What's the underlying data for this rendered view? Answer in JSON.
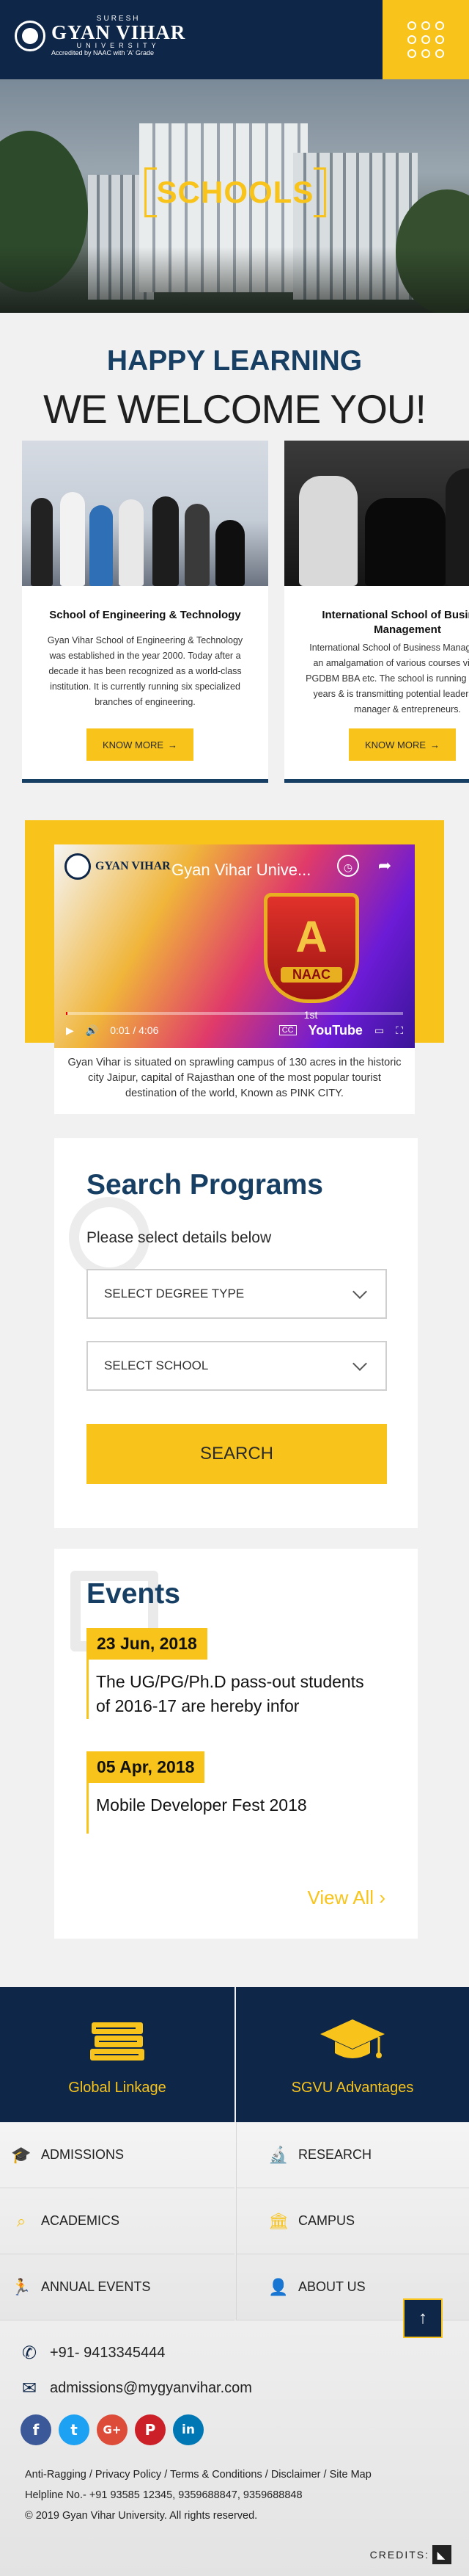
{
  "header": {
    "logo_top": "SURESH",
    "logo_name": "GYAN VIHAR",
    "logo_university": "UNIVERSITY",
    "logo_accreditation": "Accredited by NAAC with 'A' Grade"
  },
  "hero": {
    "title": "SCHOOLS"
  },
  "intro": {
    "tagline": "HAPPY LEARNING",
    "welcome": "WE WELCOME YOU!"
  },
  "schools": [
    {
      "title": "School of Engineering & Technology",
      "desc": "Gyan Vihar School of Engineering & Technology was established in the year 2000. Today after a decade it has been recognized as a world-class institution. It is currently running six specialized branches of engineering.",
      "button": "KNOW MORE"
    },
    {
      "title": "International School of Business Management",
      "desc": "International School of Business Management is an amalgamation of various courses viz. MBA, PGDBM BBA etc. The school is running for last 12 years & is transmitting potential leaders, future manager & entrepreneurs.",
      "button": "KNOW MORE"
    }
  ],
  "video": {
    "title": "Gyan Vihar Unive...",
    "badge_a": "A",
    "badge_naac": "NAAC",
    "badge_rank": "1st",
    "time": "0:01 / 4:06",
    "cc": "CC",
    "brand": "YouTube",
    "caption": "Gyan Vihar is situated on sprawling campus of 130 acres in the historic city Jaipur, capital of Rajasthan one of the most popular tourist destination of the world, Known as PINK CITY."
  },
  "search_programs": {
    "title": "Search Programs",
    "subtitle": "Please select details below",
    "degree_select": "SELECT DEGREE TYPE",
    "school_select": "SELECT SCHOOL",
    "button": "SEARCH"
  },
  "events": {
    "title": "Events",
    "items": [
      {
        "date": "23 Jun, 2018",
        "text": "The UG/PG/Ph.D pass-out students of 2016-17 are hereby infor"
      },
      {
        "date": "05 Apr, 2018",
        "text": "Mobile Developer Fest 2018"
      }
    ],
    "view_all": "View All"
  },
  "links": {
    "global": "Global Linkage",
    "advantages": "SGVU Advantages"
  },
  "footer_nav": [
    {
      "label": "ADMISSIONS",
      "icon": "graduation-cap-icon"
    },
    {
      "label": "RESEARCH",
      "icon": "microscope-icon"
    },
    {
      "label": "ACADEMICS",
      "icon": "search-icon"
    },
    {
      "label": "CAMPUS",
      "icon": "building-icon"
    },
    {
      "label": "ANNUAL EVENTS",
      "icon": "dance-icon"
    },
    {
      "label": "ABOUT US",
      "icon": "person-icon"
    }
  ],
  "contact": {
    "phone": "+91- 9413345444",
    "email": "admissions@mygyanvihar.com"
  },
  "social": [
    "f",
    "t",
    "G+",
    "P",
    "in"
  ],
  "footer": {
    "links": [
      "Anti-Ragging",
      "Privacy Policy",
      "Terms & Conditions",
      "Disclaimer",
      "Site Map"
    ],
    "helpline": "Helpline No.- +91 93585 12345, 9359688847, 9359688848",
    "copyright": "© 2019 Gyan Vihar University. All rights reserved.",
    "credits": "CREDITS:"
  },
  "colors": {
    "navy": "#0e2648",
    "accent_yellow": "#f8c41c",
    "heading_blue": "#173f64"
  }
}
